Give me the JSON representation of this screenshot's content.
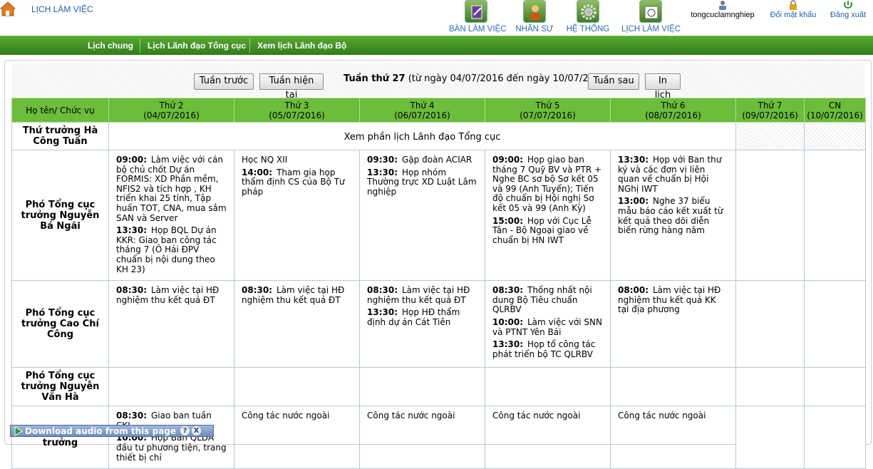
{
  "header": {
    "app_title": "LỊCH LÀM VIỆC",
    "modules": [
      {
        "label": "BÀN LÀM VIỆC",
        "icon": "desk-icon"
      },
      {
        "label": "NHÂN SỰ",
        "icon": "person-icon"
      },
      {
        "label": "HỆ THỐNG",
        "icon": "gear-icon"
      },
      {
        "label": "LỊCH LÀM VIỆC",
        "icon": "calendar-icon"
      }
    ],
    "username": "tongcuclamnghiep",
    "change_password": "Đổi mật khẩu",
    "logout": "Đăng xuất"
  },
  "nav": {
    "items": [
      "Lịch chung",
      "Lịch Lãnh đạo Tổng cục",
      "Xem lịch Lãnh đạo Bộ"
    ]
  },
  "toolbar": {
    "prev_week": "Tuần trước",
    "current_week": "Tuần hiện tại",
    "week_label": "Tuần thứ 27",
    "week_range": "(từ ngày 04/07/2016 đến ngày 10/07/2016)",
    "next_week": "Tuần sau",
    "print": "In lịch"
  },
  "table": {
    "name_header": "Họ tên/ Chức vụ",
    "days": [
      {
        "day": "Thứ 2",
        "date": "(04/07/2016)"
      },
      {
        "day": "Thứ 3",
        "date": "(05/07/2016)"
      },
      {
        "day": "Thứ 4",
        "date": "(06/07/2016)"
      },
      {
        "day": "Thứ 5",
        "date": "(07/07/2016)"
      },
      {
        "day": "Thứ 6",
        "date": "(08/07/2016)"
      },
      {
        "day": "Thứ 7",
        "date": "(09/07/2016)"
      },
      {
        "day": "CN",
        "date": "(10/07/2016)"
      }
    ],
    "note_row": {
      "name": "Thứ trưởng Hà Công Tuấn",
      "note": "Xem phần lịch Lãnh đạo Tổng cục"
    },
    "rows": [
      {
        "name": "Phó Tổng cục trưởng Nguyễn Bá Ngãi",
        "days": [
          [
            {
              "time": "09:00:",
              "text": "Làm việc với cán bộ chủ chốt Dự án FORMIS: XD Phần mềm, NFIS2 và tích hợp , KH triển khai 25 tỉnh, Tập huấn TOT, CNA, mua sắm SAN và Server"
            },
            {
              "time": "13:30:",
              "text": "Họp BQL Dự án KKR: Giao ban công tác tháng 7 (Ô Hải ĐPV chuẩn bị nội dung theo KH 23)"
            }
          ],
          [
            {
              "time": "",
              "text": "Học NQ XII"
            },
            {
              "time": "14:00:",
              "text": "Tham gia họp thẩm định CS của Bộ Tư pháp"
            }
          ],
          [
            {
              "time": "09:30:",
              "text": "Gặp đoàn ACIAR"
            },
            {
              "time": "13:30:",
              "text": "Họp nhóm Thường trực XD Luật Lâm nghiệp"
            }
          ],
          [
            {
              "time": "09:00:",
              "text": "Họp giao ban tháng 7 Quỹ BV và PTR + Nghe BC sơ bộ Sơ kết 05 và 99 (Anh Tuyển); Tiến độ chuẩn bị Hội nghị Sơ kết 05 và 99 (Anh Kỳ)"
            },
            {
              "time": "15:00:",
              "text": "Họp với Cục Lễ Tân - Bộ Ngoại giao về chuẩn bị HN IWT"
            }
          ],
          [
            {
              "time": "13:30:",
              "text": "Họp với Ban thư ký và các đơn vị liên quan về chuẩn bị Hội NGhị IWT"
            },
            {
              "time": "13:00:",
              "text": "Nghe 37 biểu mẫu báo cáo kết xuất từ kết quả theo dõi diễn biến rừng hàng năm"
            }
          ],
          [],
          []
        ]
      },
      {
        "name": "Phó Tổng cục trưởng Cao Chí Công",
        "days": [
          [
            {
              "time": "08:30:",
              "text": "Làm việc tại HĐ nghiệm thu kết quả ĐT"
            }
          ],
          [
            {
              "time": "08:30:",
              "text": "Làm việc tại HĐ nghiệm thu kết quả ĐT"
            }
          ],
          [
            {
              "time": "08:30:",
              "text": "Làm việc tại HĐ nghiệm thu kết quả ĐT"
            },
            {
              "time": "13:30:",
              "text": "Họp HĐ thẩm định dự án Cát Tiên"
            }
          ],
          [
            {
              "time": "08:30:",
              "text": "Thống nhất nội dung Bộ Tiêu chuẩn QLRBV"
            },
            {
              "time": "10:00:",
              "text": "Làm việc với SNN và PTNT Yên Bái"
            },
            {
              "time": "13:30:",
              "text": "Họp tổ công tác phát triển bộ TC QLRBV"
            }
          ],
          [
            {
              "time": "08:00:",
              "text": "Làm việc tại HĐ nghiệm thu kết quả KK tại địa phương"
            }
          ],
          [],
          []
        ]
      },
      {
        "name": "Phó Tổng cục trưởng Nguyễn Văn Hà",
        "days": [
          [],
          [],
          [],
          [],
          [],
          [],
          []
        ]
      },
      {
        "name": "Phó Tổng cục trưởng",
        "days": [
          [
            {
              "time": "08:30:",
              "text": "Giao ban tuần CKL"
            },
            {
              "time": "10:00:",
              "text": "Họp Ban QLDA đầu tư phương tiện, trang thiết bị chỉ"
            }
          ],
          [
            {
              "time": "",
              "text": "Công tác nước ngoài"
            }
          ],
          [
            {
              "time": "",
              "text": "Công tác nước ngoài"
            }
          ],
          [
            {
              "time": "",
              "text": "Công tác nước ngoài"
            }
          ],
          [
            {
              "time": "",
              "text": "Công tác nước ngoài"
            }
          ],
          [],
          []
        ]
      }
    ]
  },
  "download_bar": {
    "text": "Download audio from this page",
    "help": "?",
    "close": "X"
  },
  "colors": {
    "nav_green": "#3d8f22",
    "header_green": "#6bbd3a",
    "link_blue": "#1f5fb0"
  }
}
